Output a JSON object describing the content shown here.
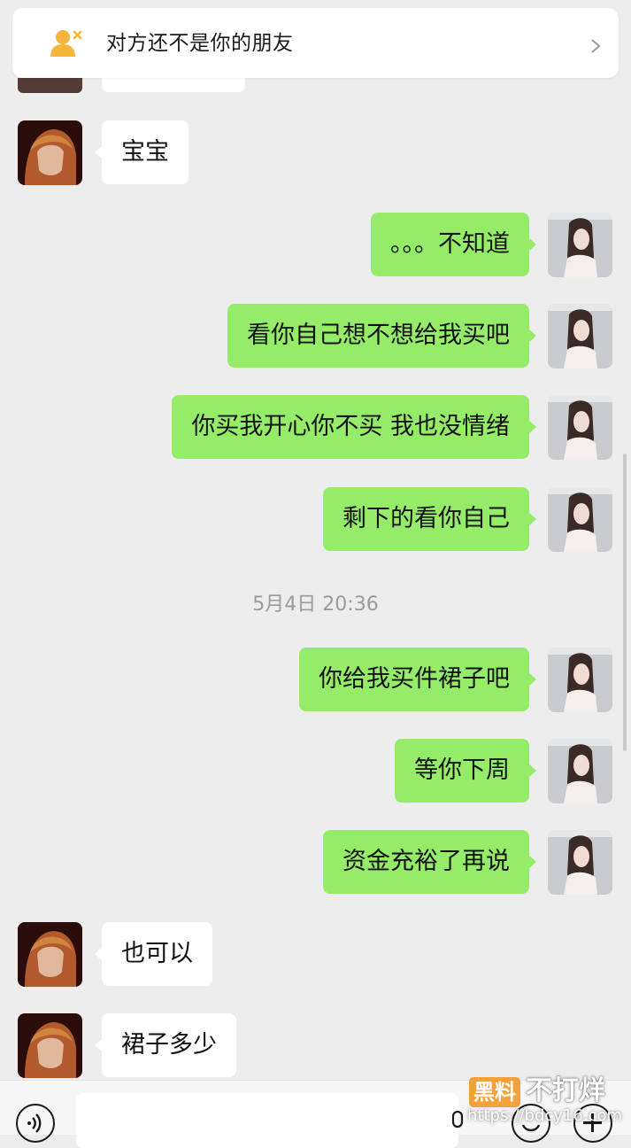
{
  "banner": {
    "text": "对方还不是你的朋友"
  },
  "messages": [
    {
      "side": "left",
      "text": "宝宝"
    },
    {
      "side": "right",
      "text": "。。。不知道"
    },
    {
      "side": "right",
      "text": "看你自己想不想给我买吧"
    },
    {
      "side": "right",
      "text": "你买我开心你不买 我也没情绪"
    },
    {
      "side": "right",
      "text": "剩下的看你自己"
    },
    {
      "side": "right",
      "text": "你给我买件裙子吧"
    },
    {
      "side": "right",
      "text": "等你下周"
    },
    {
      "side": "right",
      "text": "资金充裕了再说"
    },
    {
      "side": "left",
      "text": "也可以"
    },
    {
      "side": "left",
      "text": "裙子多少"
    }
  ],
  "timestamp": "5月4日 20:36",
  "input": {
    "value": ""
  },
  "watermark": {
    "logo": "黑料",
    "name": "不打烊",
    "url": "https://bdcy16.com"
  },
  "colors": {
    "self_bubble": "#95ec69",
    "other_bubble": "#ffffff",
    "background": "#ededed"
  }
}
